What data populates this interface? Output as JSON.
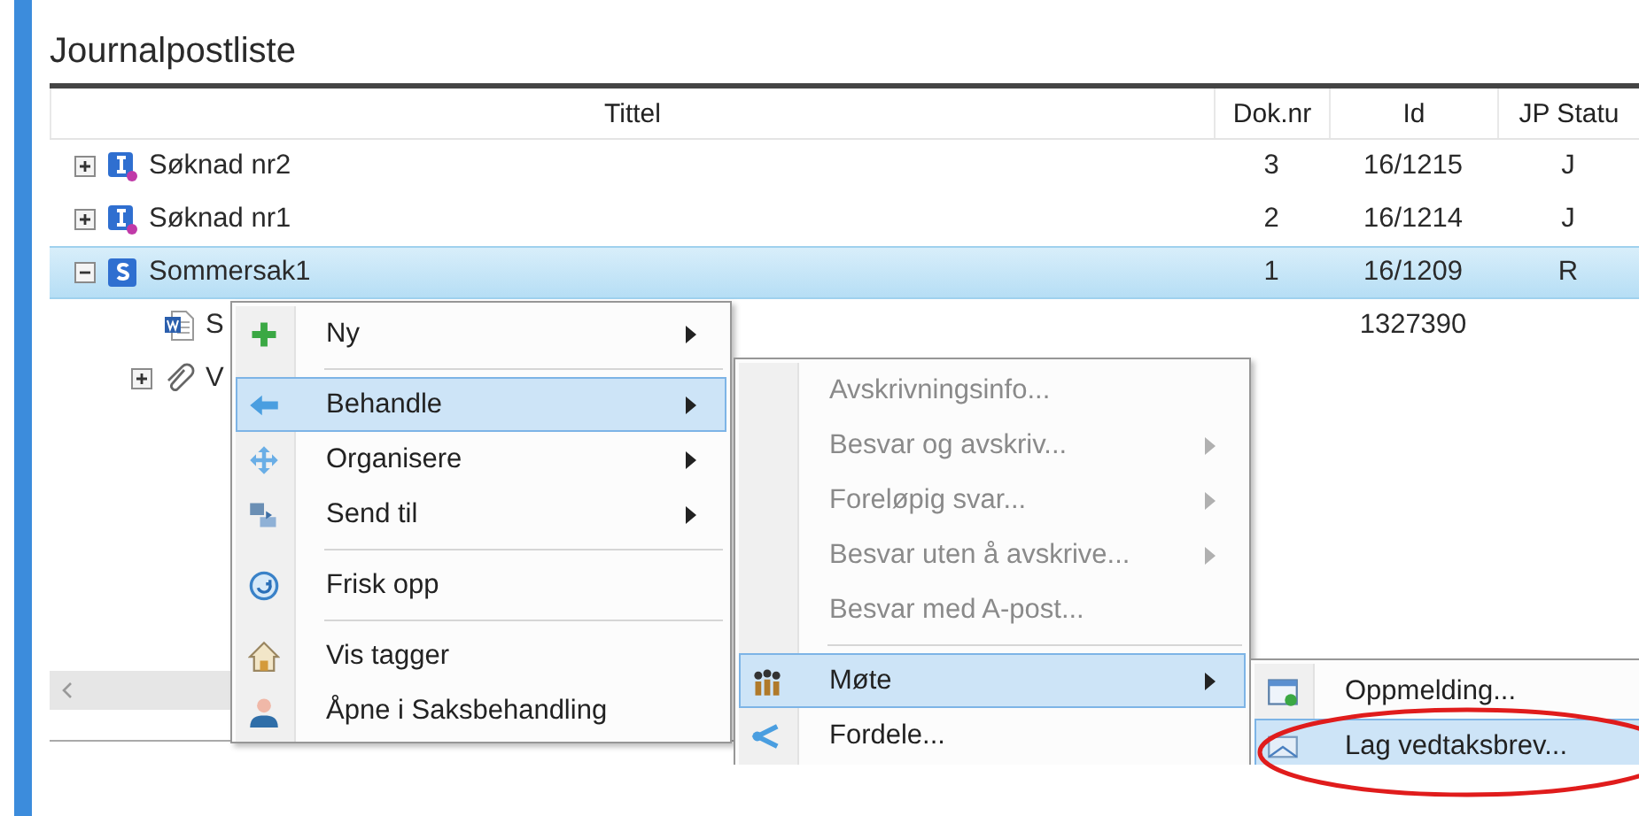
{
  "title": "Journalpostliste",
  "table": {
    "columns": [
      {
        "label": "Tittel"
      },
      {
        "label": "Dok.nr"
      },
      {
        "label": "Id"
      },
      {
        "label": "JP Statu"
      }
    ],
    "rows": [
      {
        "kind": "incoming",
        "expanded": false,
        "title": "Søknad nr2",
        "dok_nr": "3",
        "id": "16/1215",
        "jp_status": "J",
        "selected": false
      },
      {
        "kind": "incoming",
        "expanded": false,
        "title": "Søknad nr1",
        "dok_nr": "2",
        "id": "16/1214",
        "jp_status": "J",
        "selected": false
      },
      {
        "kind": "case",
        "expanded": true,
        "title": "Sommersak1",
        "dok_nr": "1",
        "id": "16/1209",
        "jp_status": "R",
        "selected": true,
        "children": [
          {
            "kind": "document",
            "title": "S",
            "id": "1327390",
            "selected": false
          },
          {
            "kind": "attachment",
            "expanded": false,
            "title": "V",
            "selected": false
          }
        ]
      }
    ]
  },
  "menus": [
    {
      "items": [
        {
          "kind": "item",
          "label": "Ny",
          "submenu": true,
          "selected": false,
          "disabled": false
        },
        {
          "kind": "separator"
        },
        {
          "kind": "item",
          "label": "Behandle",
          "submenu": true,
          "selected": true,
          "disabled": false
        },
        {
          "kind": "item",
          "label": "Organisere",
          "submenu": true,
          "selected": false,
          "disabled": false
        },
        {
          "kind": "item",
          "label": "Send til",
          "submenu": true,
          "selected": false,
          "disabled": false
        },
        {
          "kind": "separator"
        },
        {
          "kind": "item",
          "label": "Frisk opp",
          "submenu": false,
          "selected": false,
          "disabled": false
        },
        {
          "kind": "separator"
        },
        {
          "kind": "item",
          "label": "Vis tagger",
          "submenu": false,
          "selected": false,
          "disabled": false
        },
        {
          "kind": "item",
          "label": "Åpne i Saksbehandling",
          "submenu": false,
          "selected": false,
          "disabled": false
        }
      ]
    },
    {
      "items": [
        {
          "kind": "item",
          "label": "Avskrivningsinfo...",
          "submenu": false,
          "selected": false,
          "disabled": true
        },
        {
          "kind": "item",
          "label": "Besvar og avskriv...",
          "submenu": true,
          "selected": false,
          "disabled": true
        },
        {
          "kind": "item",
          "label": "Foreløpig svar...",
          "submenu": true,
          "selected": false,
          "disabled": true
        },
        {
          "kind": "item",
          "label": "Besvar uten å avskrive...",
          "submenu": true,
          "selected": false,
          "disabled": true
        },
        {
          "kind": "item",
          "label": "Besvar med A-post...",
          "submenu": false,
          "selected": false,
          "disabled": true
        },
        {
          "kind": "separator"
        },
        {
          "kind": "item",
          "label": "Møte",
          "submenu": true,
          "selected": true,
          "disabled": false
        },
        {
          "kind": "item",
          "label": "Fordele...",
          "submenu": false,
          "selected": false,
          "disabled": false
        }
      ]
    },
    {
      "items": [
        {
          "kind": "item",
          "label": "Oppmelding...",
          "submenu": false,
          "selected": false,
          "disabled": false
        },
        {
          "kind": "item",
          "label": "Lag vedtaksbrev...",
          "submenu": false,
          "selected": true,
          "disabled": false
        }
      ]
    }
  ],
  "annotations": [
    {
      "kind": "ellipse"
    }
  ]
}
